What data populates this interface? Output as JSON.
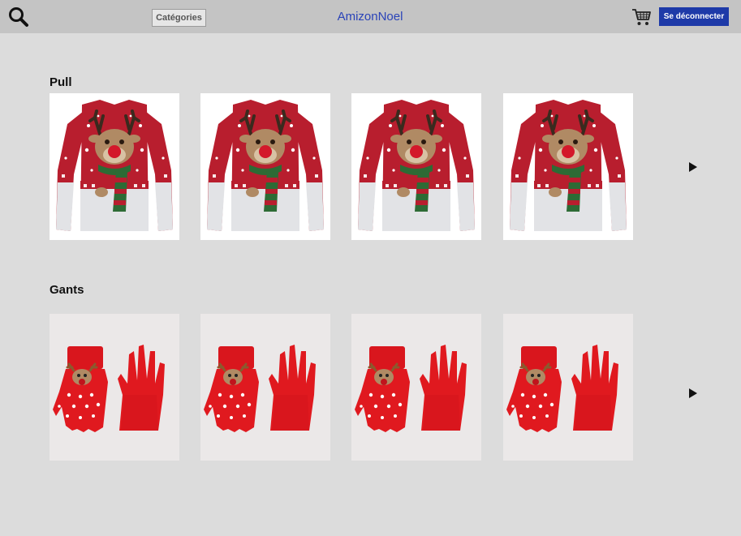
{
  "header": {
    "search_icon": "search-icon",
    "categories_label": "Catégories",
    "brand": "AmizonNoel",
    "cart_icon": "cart-icon",
    "logout_label": "Se déconnecter"
  },
  "sections": [
    {
      "title": "Pull",
      "product_image": "christmas-sweater-reindeer",
      "item_count": 4,
      "next_icon": "play-arrow-icon"
    },
    {
      "title": "Gants",
      "product_image": "christmas-gloves-reindeer",
      "item_count": 4,
      "next_icon": "play-arrow-icon"
    }
  ],
  "colors": {
    "header_bg": "#c4c4c4",
    "page_bg": "#dcdcdc",
    "brand": "#2a43b8",
    "logout_bg": "#1e3aa8",
    "sweater_red": "#b81e2e",
    "glove_red": "#e0191f"
  }
}
